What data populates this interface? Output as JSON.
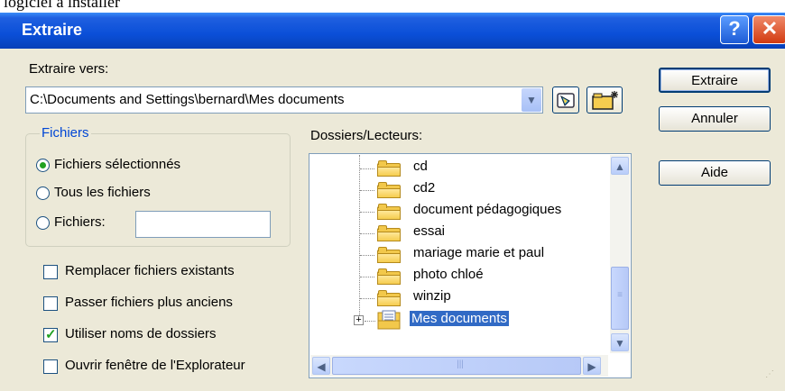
{
  "top_fragment": "logiciel à installer",
  "window": {
    "title": "Extraire",
    "help_glyph": "?",
    "close_glyph": "✕"
  },
  "extract_to": {
    "label": "Extraire vers:",
    "path": "C:\\Documents and Settings\\bernard\\Mes documents"
  },
  "buttons": {
    "extract": "Extraire",
    "cancel": "Annuler",
    "help": "Aide"
  },
  "files_group": {
    "title": "Fichiers",
    "options": [
      {
        "label": "Fichiers sélectionnés",
        "selected": true
      },
      {
        "label": "Tous les fichiers",
        "selected": false
      },
      {
        "label": "Fichiers:",
        "selected": false
      }
    ],
    "pattern_value": ""
  },
  "checkboxes": [
    {
      "label": "Remplacer fichiers existants",
      "checked": false
    },
    {
      "label": "Passer fichiers plus anciens",
      "checked": false
    },
    {
      "label": "Utiliser noms de dossiers",
      "checked": true
    },
    {
      "label": "Ouvrir fenêtre de l'Explorateur",
      "checked": false
    }
  ],
  "folders": {
    "label": "Dossiers/Lecteurs:",
    "items": [
      {
        "name": "cd"
      },
      {
        "name": "cd2"
      },
      {
        "name": "document pédagogiques"
      },
      {
        "name": "essai"
      },
      {
        "name": "mariage marie et paul"
      },
      {
        "name": "photo chloé"
      },
      {
        "name": "winzip"
      },
      {
        "name": "Mes documents",
        "selected": true,
        "expandable": true
      }
    ]
  },
  "icons": {
    "combo_arrow": "chevron-down-icon",
    "up_folder": "up-folder-icon",
    "new_folder": "new-folder-icon",
    "folder": "folder-icon",
    "expand": "plus-box-icon"
  },
  "colors": {
    "title_bar": "#0a4fd8",
    "selection": "#316ac5",
    "face": "#ece9d8",
    "group_title": "#0046d5"
  }
}
